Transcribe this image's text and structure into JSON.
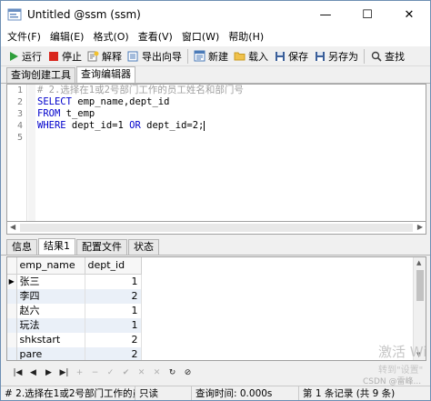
{
  "window": {
    "title": "Untitled @ssm (ssm)",
    "minimize": "—",
    "maximize": "☐",
    "close": "✕"
  },
  "menu": {
    "items": [
      "文件(F)",
      "编辑(E)",
      "格式(O)",
      "查看(V)",
      "窗口(W)",
      "帮助(H)"
    ]
  },
  "toolbar": {
    "run": "运行",
    "stop": "停止",
    "explain": "解释",
    "export_wizard": "导出向导",
    "new": "新建",
    "load": "载入",
    "save": "保存",
    "save_as": "另存为",
    "find": "查找"
  },
  "tabs": {
    "query_builder": "查询创建工具",
    "query_editor": "查询编辑器"
  },
  "editor": {
    "line_numbers": [
      "1",
      "2",
      "3",
      "4",
      "5"
    ],
    "line1": "# 2.选择在1或2号部门工作的员工姓名和部门号",
    "line2_kw": "SELECT",
    "line2_rest": " emp_name,dept_id",
    "line3_kw": "FROM",
    "line3_rest": " t_emp",
    "line4_kw1": "WHERE",
    "line4_mid1": " dept_id=1 ",
    "line4_kw2": "OR",
    "line4_mid2": " dept_id=2;"
  },
  "result_tabs": {
    "info": "信息",
    "result1": "结果1",
    "profile": "配置文件",
    "status": "状态"
  },
  "grid": {
    "columns": [
      "emp_name",
      "dept_id"
    ],
    "rows": [
      {
        "emp_name": "张三",
        "dept_id": "1"
      },
      {
        "emp_name": "李四",
        "dept_id": "2"
      },
      {
        "emp_name": "赵六",
        "dept_id": "1"
      },
      {
        "emp_name": "玩法",
        "dept_id": "1"
      },
      {
        "emp_name": "shkstart",
        "dept_id": "2"
      },
      {
        "emp_name": "pare",
        "dept_id": "2"
      }
    ],
    "row_indicator": "▶"
  },
  "navbar": {
    "first": "|◀",
    "prev": "◀",
    "next": "▶",
    "last": "▶|",
    "add": "+",
    "delete": "−",
    "edit": "✓",
    "apply": "✔",
    "cancel": "✕",
    "stop": "✕",
    "refresh": "↻",
    "halt": "⊘"
  },
  "status": {
    "sql": "# 2.选择在1或2号部门工作的员工",
    "readonly": "只读",
    "query_time": "查询时间: 0.000s",
    "records": "第 1 条记录 (共 9 条)"
  },
  "watermark": {
    "activate": "激活 Wi",
    "goto_settings": "转到\"设置\"",
    "csdn": "CSDN @雷峰..."
  }
}
